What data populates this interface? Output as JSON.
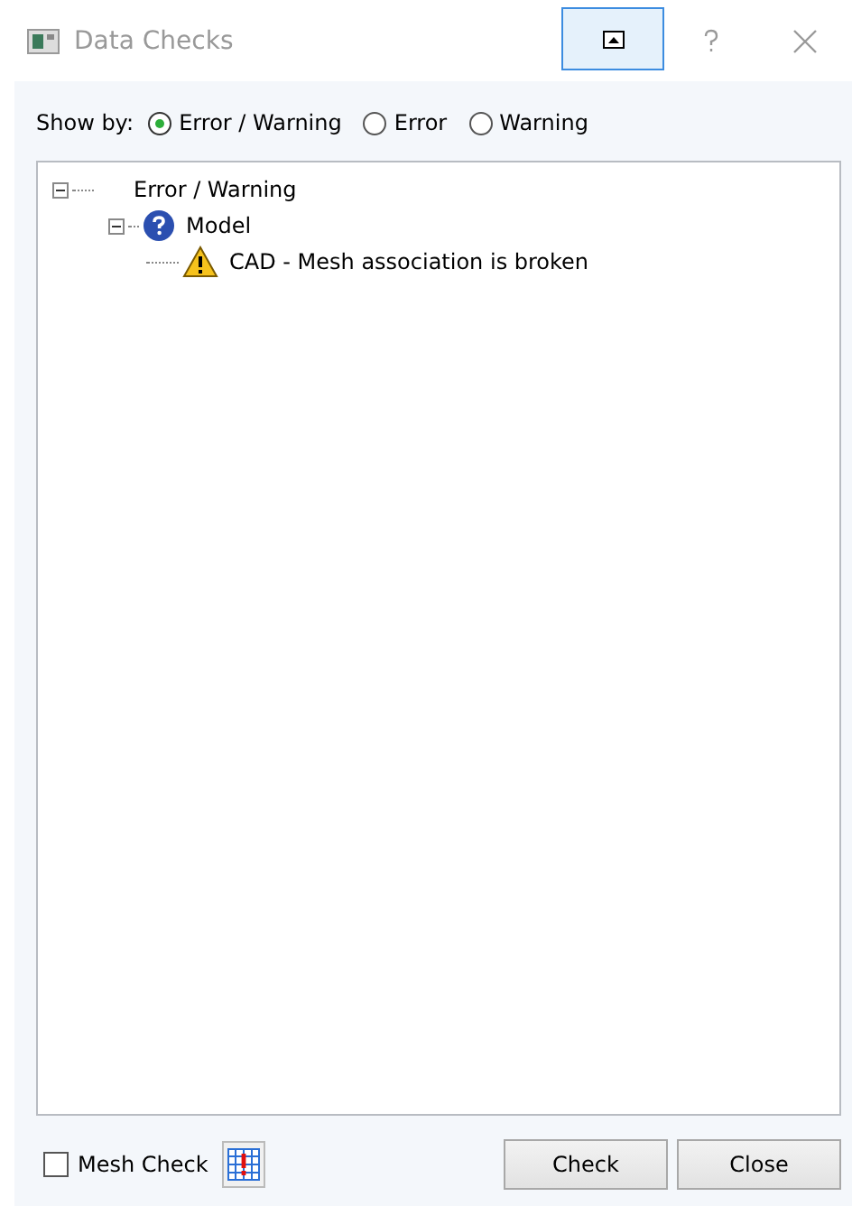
{
  "window": {
    "title": "Data Checks"
  },
  "show_by": {
    "label": "Show by:",
    "options": [
      {
        "label": "Error / Warning",
        "selected": true
      },
      {
        "label": "Error",
        "selected": false
      },
      {
        "label": "Warning",
        "selected": false
      }
    ]
  },
  "tree": [
    {
      "label": "Error / Warning",
      "expanded": true,
      "children": [
        {
          "label": "Model",
          "kind": "group",
          "expanded": true,
          "children": [
            {
              "label": "CAD - Mesh association is broken",
              "kind": "warning"
            }
          ]
        }
      ]
    }
  ],
  "mesh_check": {
    "label": "Mesh Check",
    "checked": false
  },
  "buttons": [
    "Check",
    "Close"
  ]
}
